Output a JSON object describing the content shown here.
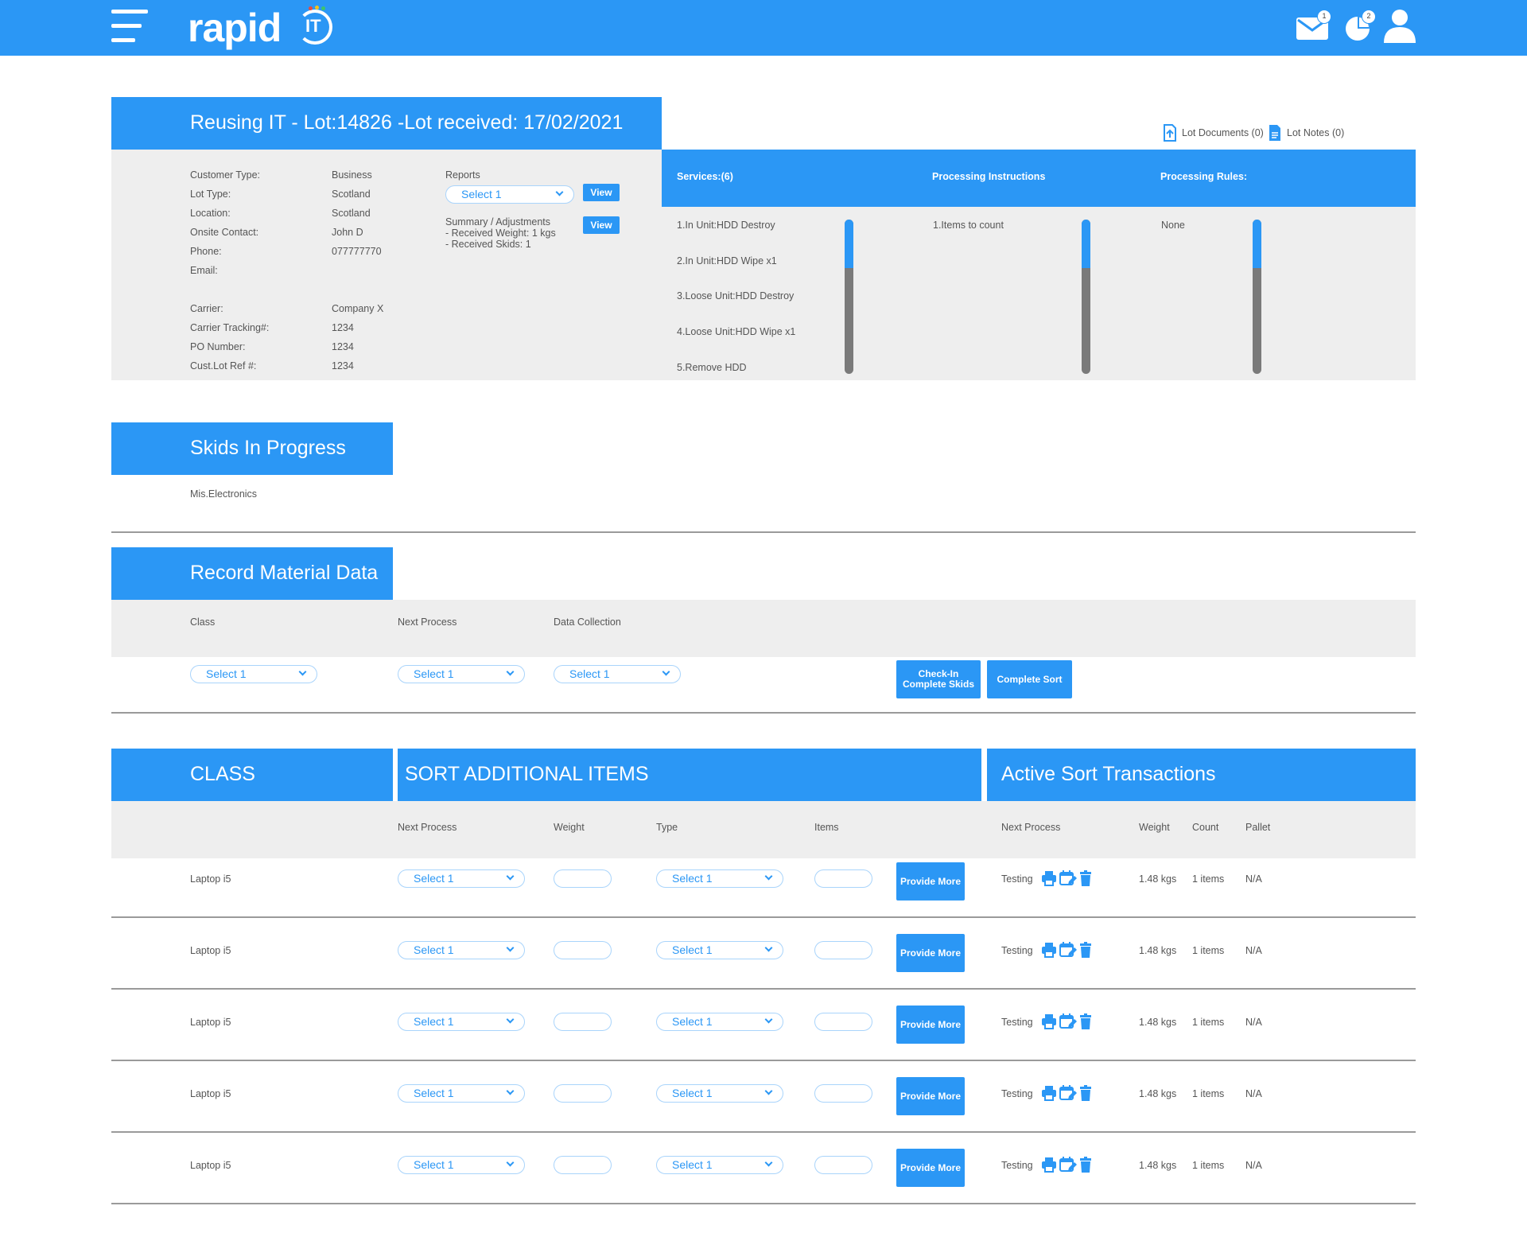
{
  "header": {
    "logo_text": "rapid",
    "logo_badge": "IT",
    "mail_count": "1",
    "pie_count": "2"
  },
  "lot": {
    "title": "Reusing IT - Lot:14826 -Lot received: 17/02/2021",
    "documents_label": "Lot Documents (0)",
    "notes_label": "Lot Notes (0)",
    "details": [
      {
        "label": "Customer Type:",
        "value": "Business"
      },
      {
        "label": "Lot Type:",
        "value": "Scotland"
      },
      {
        "label": "Location:",
        "value": "Scotland"
      },
      {
        "label": "Onsite Contact:",
        "value": "John D"
      },
      {
        "label": "Phone:",
        "value": "077777770"
      },
      {
        "label": "Email:",
        "value": ""
      }
    ],
    "carrier_details": [
      {
        "label": "Carrier:",
        "value": "Company X"
      },
      {
        "label": "Carrier Tracking#:",
        "value": "1234"
      },
      {
        "label": "PO Number:",
        "value": "1234"
      },
      {
        "label": "Cust.Lot Ref #:",
        "value": "1234"
      }
    ],
    "reports_label": "Reports",
    "reports_select": "Select 1",
    "view_label": "View",
    "summary_title": "Summary / Adjustments",
    "summary_weight": "- Received Weight: 1 kgs",
    "summary_skids": "- Received Skids: 1",
    "services_header": "Services:(6)",
    "instructions_header": "Processing Instructions",
    "rules_header": "Processing Rules:",
    "services": [
      "1.In Unit:HDD Destroy",
      "2.In Unit:HDD Wipe x1",
      "3.Loose Unit:HDD Destroy",
      "4.Loose Unit:HDD Wipe x1",
      "5.Remove HDD"
    ],
    "instructions": [
      "1.Items to count"
    ],
    "rules": [
      "None"
    ]
  },
  "skids": {
    "title": "Skids In Progress",
    "item": "Mis.Electronics"
  },
  "record": {
    "title": "Record Material Data",
    "class_label": "Class",
    "next_process_label": "Next Process",
    "data_collection_label": "Data Collection",
    "class_select": "Select 1",
    "next_process_select": "Select 1",
    "data_collection_select": "Select 1",
    "checkin_label": "Check-In\nComplete Skids",
    "complete_sort_label": "Complete Sort"
  },
  "sort": {
    "class_title": "CLASS",
    "additional_title": "SORT ADDITIONAL ITEMS",
    "active_title": "Active Sort Transactions",
    "columns": {
      "next_process": "Next Process",
      "weight": "Weight",
      "type": "Type",
      "items": "Items",
      "active_next_process": "Next Process",
      "active_weight": "Weight",
      "count": "Count",
      "pallet": "Pallet"
    },
    "provide_more_label": "Provide More",
    "rows": [
      {
        "class": "Laptop i5",
        "next_process": "Select 1",
        "type": "Select 1",
        "active_process": "Testing",
        "weight": "1.48 kgs",
        "count": "1 items",
        "pallet": "N/A"
      },
      {
        "class": "Laptop i5",
        "next_process": "Select 1",
        "type": "Select 1",
        "active_process": "Testing",
        "weight": "1.48 kgs",
        "count": "1 items",
        "pallet": "N/A"
      },
      {
        "class": "Laptop i5",
        "next_process": "Select 1",
        "type": "Select 1",
        "active_process": "Testing",
        "weight": "1.48 kgs",
        "count": "1 items",
        "pallet": "N/A"
      },
      {
        "class": "Laptop i5",
        "next_process": "Select 1",
        "type": "Select 1",
        "active_process": "Testing",
        "weight": "1.48 kgs",
        "count": "1 items",
        "pallet": "N/A"
      },
      {
        "class": "Laptop i5",
        "next_process": "Select 1",
        "type": "Select 1",
        "active_process": "Testing",
        "weight": "1.48 kgs",
        "count": "1 items",
        "pallet": "N/A"
      }
    ]
  },
  "colors": {
    "accent": "#2b97f5",
    "panel": "#eeeeee"
  }
}
